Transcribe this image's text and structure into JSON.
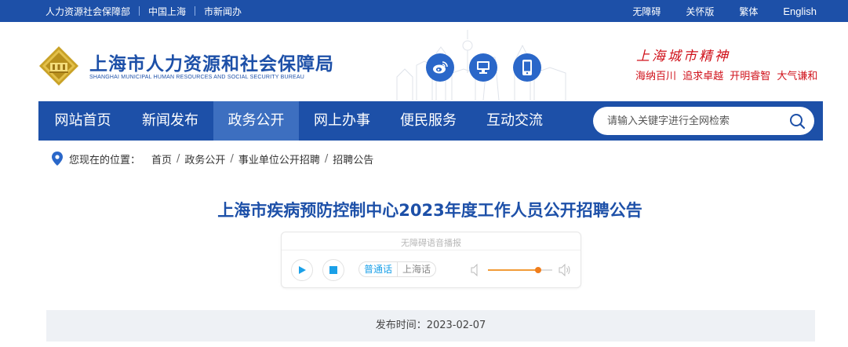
{
  "topbar": {
    "links": [
      "人力资源社会保障部",
      "中国上海",
      "市新闻办"
    ],
    "right_links": [
      "无障碍",
      "关怀版",
      "繁体",
      "English"
    ]
  },
  "header": {
    "logo_cn": "上海市人力资源和社会保障局",
    "logo_en": "SHANGHAI MUNICIPAL HUMAN RESOURCES AND SOCIAL SECURITY BUREAU",
    "spirit_title": "上海城市精神",
    "spirit_words": "海纳百川 追求卓越 开明睿智 大气谦和",
    "social_icons": [
      "weibo-icon",
      "computer-icon",
      "mobile-icon"
    ]
  },
  "nav": {
    "items": [
      "网站首页",
      "新闻发布",
      "政务公开",
      "网上办事",
      "便民服务",
      "互动交流"
    ],
    "active_index": 2,
    "search_placeholder": "请输入关键字进行全网检索"
  },
  "breadcrumb": {
    "label": "您现在的位置：",
    "items": [
      "首页",
      "政务公开",
      "事业单位公开招聘",
      "招聘公告"
    ]
  },
  "article": {
    "title": "上海市疾病预防控制中心2023年度工作人员公开招聘公告"
  },
  "player": {
    "title": "无障碍语音播报",
    "lang_active": "普通话",
    "lang_other": "上海话",
    "volume_fraction": 0.78,
    "accent_color": "#1aa0e8",
    "slider_color": "#f07d1c"
  },
  "publish": {
    "label": "发布时间：",
    "date": "2023-02-07"
  },
  "colors": {
    "brand_blue": "#1d50a8",
    "nav_active": "#3d6fc0",
    "spirit_red": "#d0121b"
  }
}
